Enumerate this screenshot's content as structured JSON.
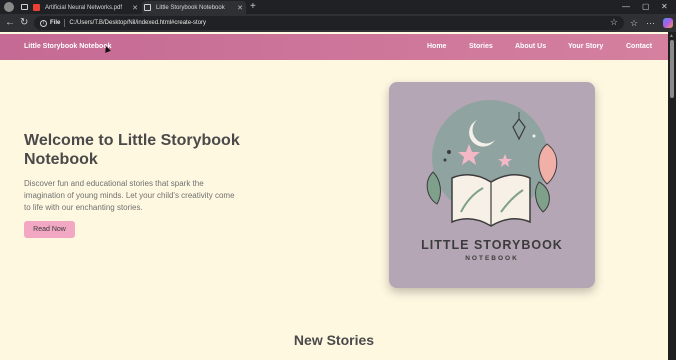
{
  "browser": {
    "tabs": [
      {
        "label": "Artificial Neural Networks.pdf"
      },
      {
        "label": "Little Storybook Notebook"
      }
    ],
    "address": {
      "scheme_label": "File",
      "url": "C:/Users/T.B/Desktop/Nil/indexed.html#create-story"
    },
    "window_controls": {
      "minimize": "—",
      "maximize": "▢",
      "close": "✕"
    }
  },
  "site": {
    "brand": "Little Storybook Notebook",
    "nav": [
      {
        "label": "Home"
      },
      {
        "label": "Stories"
      },
      {
        "label": "About Us"
      },
      {
        "label": "Your Story"
      },
      {
        "label": "Contact"
      }
    ],
    "hero": {
      "title": "Welcome to Little Storybook Notebook",
      "text": "Discover fun and educational stories that spark the imagination of young minds. Let your child's creativity come to life with our enchanting stories.",
      "button": "Read Now"
    },
    "cover": {
      "title": "LITTLE STORYBOOK",
      "subtitle": "NOTEBOOK"
    },
    "section_title": "New Stories"
  },
  "colors": {
    "nav_gradient_start": "#c56a94",
    "nav_gradient_end": "#d5809f",
    "page_background": "#fff8e1",
    "button_pink": "#f2a7c2"
  }
}
